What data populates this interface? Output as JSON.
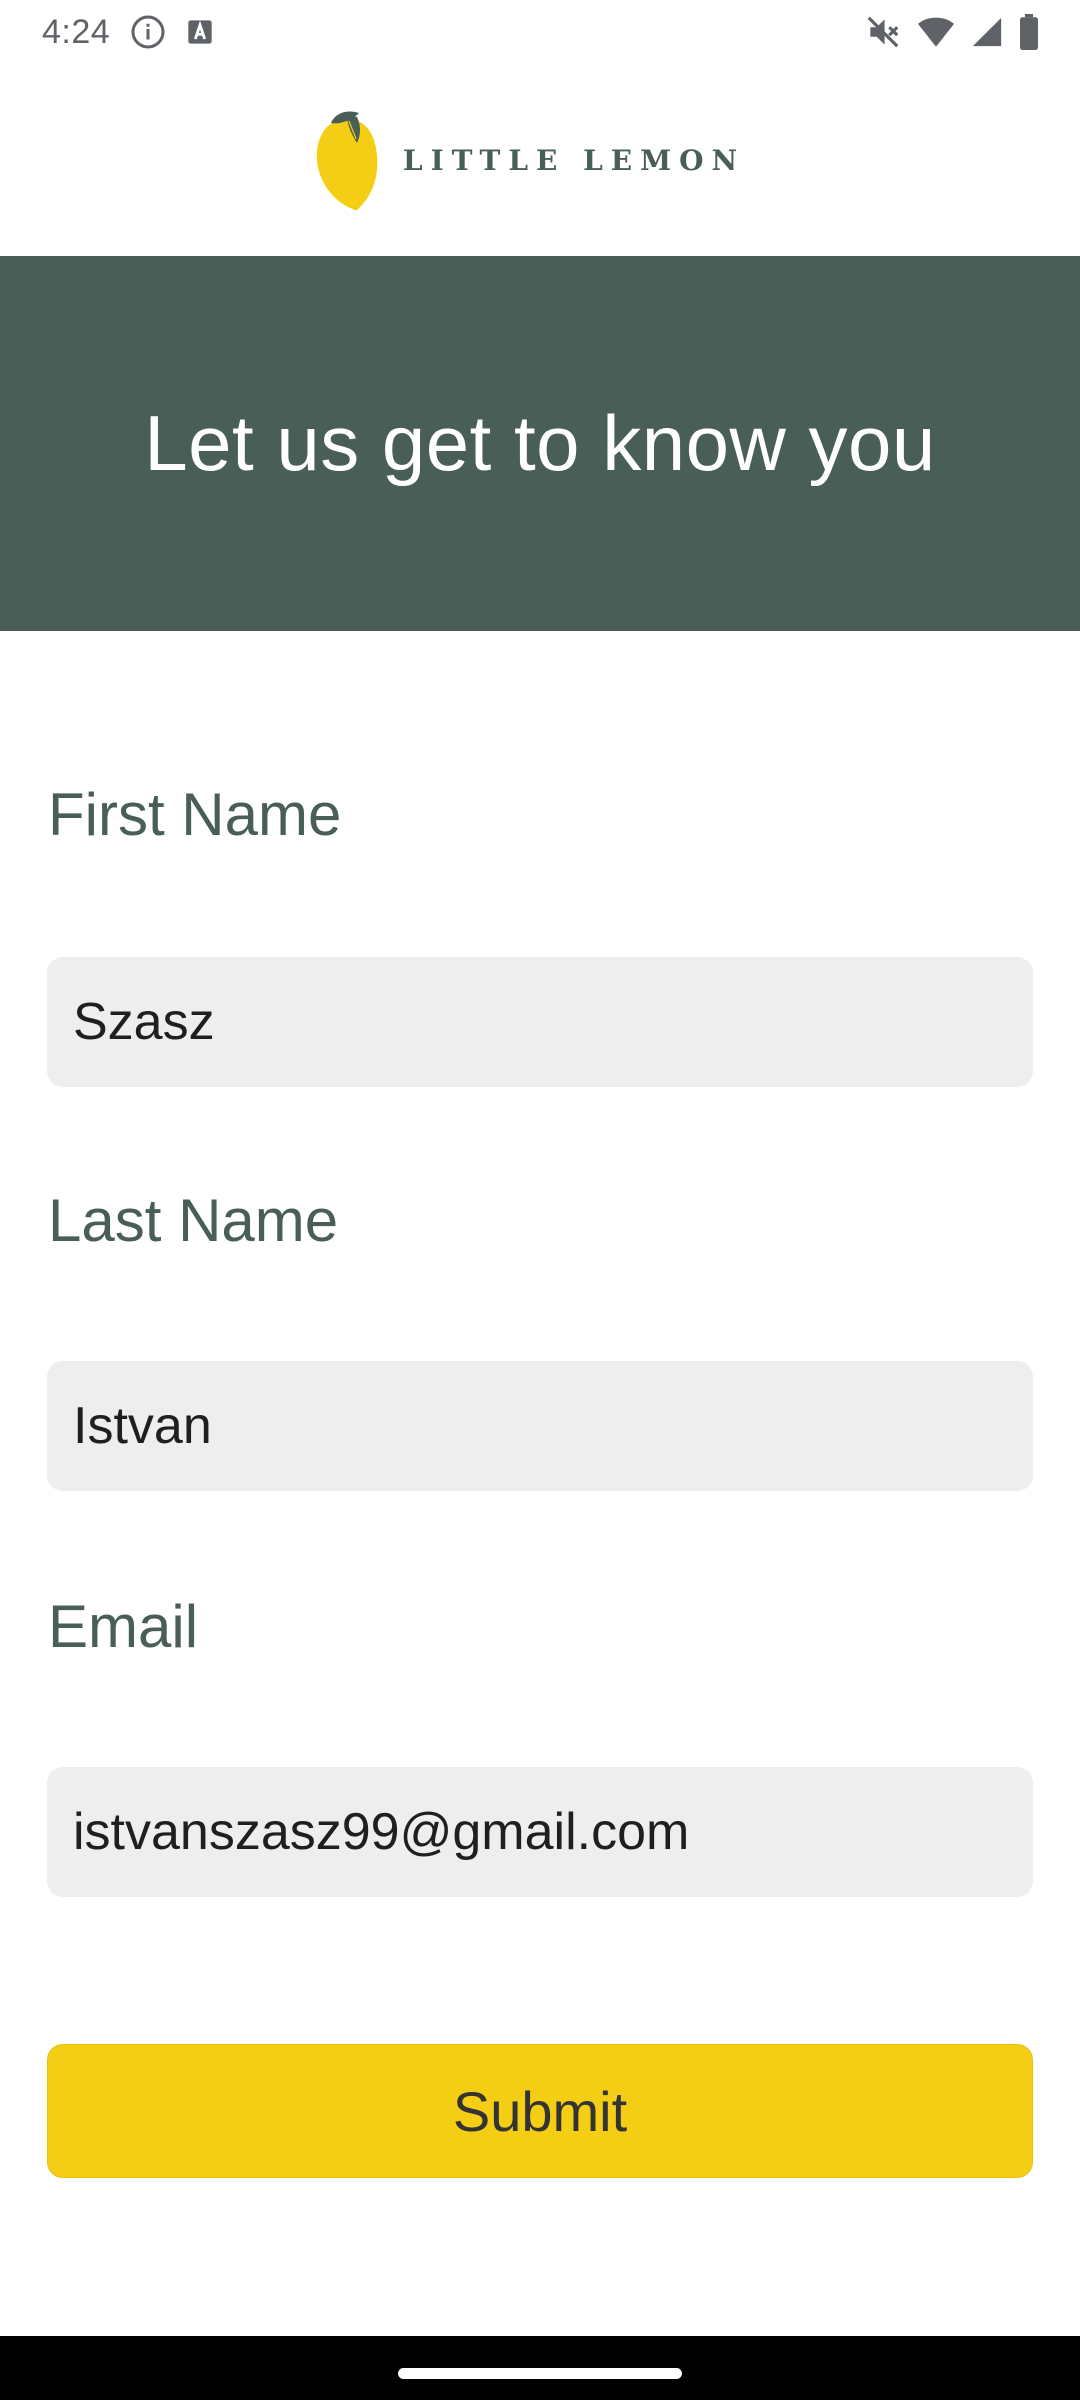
{
  "status_bar": {
    "time": "4:24",
    "icons": [
      "info-icon",
      "a-icon",
      "mute-icon",
      "wifi-icon",
      "signal-icon",
      "battery-icon"
    ]
  },
  "header": {
    "logo_text": "LITTLE LEMON",
    "logo_icon": "lemon-icon"
  },
  "hero": {
    "title": "Let us get to know you"
  },
  "form": {
    "first_name": {
      "label": "First Name",
      "value": "Szasz"
    },
    "last_name": {
      "label": "Last Name",
      "value": "Istvan"
    },
    "email": {
      "label": "Email",
      "value": "istvanszasz99@gmail.com"
    },
    "submit_label": "Submit"
  },
  "colors": {
    "primary_green": "#495e57",
    "accent_yellow": "#f4ce14",
    "input_bg": "#edeeed"
  }
}
